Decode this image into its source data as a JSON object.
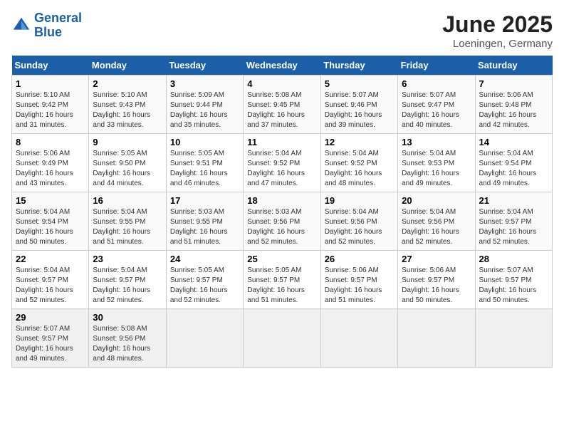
{
  "header": {
    "logo_line1": "General",
    "logo_line2": "Blue",
    "title": "June 2025",
    "subtitle": "Loeningen, Germany"
  },
  "calendar": {
    "days_of_week": [
      "Sunday",
      "Monday",
      "Tuesday",
      "Wednesday",
      "Thursday",
      "Friday",
      "Saturday"
    ],
    "weeks": [
      [
        {
          "day": "",
          "info": ""
        },
        {
          "day": "",
          "info": ""
        },
        {
          "day": "",
          "info": ""
        },
        {
          "day": "",
          "info": ""
        },
        {
          "day": "",
          "info": ""
        },
        {
          "day": "",
          "info": ""
        },
        {
          "day": "7",
          "info": "Sunrise: 5:06 AM\nSunset: 9:48 PM\nDaylight: 16 hours\nand 42 minutes."
        }
      ],
      [
        {
          "day": "1",
          "info": "Sunrise: 5:10 AM\nSunset: 9:42 PM\nDaylight: 16 hours\nand 31 minutes."
        },
        {
          "day": "2",
          "info": "Sunrise: 5:10 AM\nSunset: 9:43 PM\nDaylight: 16 hours\nand 33 minutes."
        },
        {
          "day": "3",
          "info": "Sunrise: 5:09 AM\nSunset: 9:44 PM\nDaylight: 16 hours\nand 35 minutes."
        },
        {
          "day": "4",
          "info": "Sunrise: 5:08 AM\nSunset: 9:45 PM\nDaylight: 16 hours\nand 37 minutes."
        },
        {
          "day": "5",
          "info": "Sunrise: 5:07 AM\nSunset: 9:46 PM\nDaylight: 16 hours\nand 39 minutes."
        },
        {
          "day": "6",
          "info": "Sunrise: 5:07 AM\nSunset: 9:47 PM\nDaylight: 16 hours\nand 40 minutes."
        },
        {
          "day": "7",
          "info": "Sunrise: 5:06 AM\nSunset: 9:48 PM\nDaylight: 16 hours\nand 42 minutes."
        }
      ],
      [
        {
          "day": "8",
          "info": "Sunrise: 5:06 AM\nSunset: 9:49 PM\nDaylight: 16 hours\nand 43 minutes."
        },
        {
          "day": "9",
          "info": "Sunrise: 5:05 AM\nSunset: 9:50 PM\nDaylight: 16 hours\nand 44 minutes."
        },
        {
          "day": "10",
          "info": "Sunrise: 5:05 AM\nSunset: 9:51 PM\nDaylight: 16 hours\nand 46 minutes."
        },
        {
          "day": "11",
          "info": "Sunrise: 5:04 AM\nSunset: 9:52 PM\nDaylight: 16 hours\nand 47 minutes."
        },
        {
          "day": "12",
          "info": "Sunrise: 5:04 AM\nSunset: 9:52 PM\nDaylight: 16 hours\nand 48 minutes."
        },
        {
          "day": "13",
          "info": "Sunrise: 5:04 AM\nSunset: 9:53 PM\nDaylight: 16 hours\nand 49 minutes."
        },
        {
          "day": "14",
          "info": "Sunrise: 5:04 AM\nSunset: 9:54 PM\nDaylight: 16 hours\nand 49 minutes."
        }
      ],
      [
        {
          "day": "15",
          "info": "Sunrise: 5:04 AM\nSunset: 9:54 PM\nDaylight: 16 hours\nand 50 minutes."
        },
        {
          "day": "16",
          "info": "Sunrise: 5:04 AM\nSunset: 9:55 PM\nDaylight: 16 hours\nand 51 minutes."
        },
        {
          "day": "17",
          "info": "Sunrise: 5:03 AM\nSunset: 9:55 PM\nDaylight: 16 hours\nand 51 minutes."
        },
        {
          "day": "18",
          "info": "Sunrise: 5:03 AM\nSunset: 9:56 PM\nDaylight: 16 hours\nand 52 minutes."
        },
        {
          "day": "19",
          "info": "Sunrise: 5:04 AM\nSunset: 9:56 PM\nDaylight: 16 hours\nand 52 minutes."
        },
        {
          "day": "20",
          "info": "Sunrise: 5:04 AM\nSunset: 9:56 PM\nDaylight: 16 hours\nand 52 minutes."
        },
        {
          "day": "21",
          "info": "Sunrise: 5:04 AM\nSunset: 9:57 PM\nDaylight: 16 hours\nand 52 minutes."
        }
      ],
      [
        {
          "day": "22",
          "info": "Sunrise: 5:04 AM\nSunset: 9:57 PM\nDaylight: 16 hours\nand 52 minutes."
        },
        {
          "day": "23",
          "info": "Sunrise: 5:04 AM\nSunset: 9:57 PM\nDaylight: 16 hours\nand 52 minutes."
        },
        {
          "day": "24",
          "info": "Sunrise: 5:05 AM\nSunset: 9:57 PM\nDaylight: 16 hours\nand 52 minutes."
        },
        {
          "day": "25",
          "info": "Sunrise: 5:05 AM\nSunset: 9:57 PM\nDaylight: 16 hours\nand 51 minutes."
        },
        {
          "day": "26",
          "info": "Sunrise: 5:06 AM\nSunset: 9:57 PM\nDaylight: 16 hours\nand 51 minutes."
        },
        {
          "day": "27",
          "info": "Sunrise: 5:06 AM\nSunset: 9:57 PM\nDaylight: 16 hours\nand 50 minutes."
        },
        {
          "day": "28",
          "info": "Sunrise: 5:07 AM\nSunset: 9:57 PM\nDaylight: 16 hours\nand 50 minutes."
        }
      ],
      [
        {
          "day": "29",
          "info": "Sunrise: 5:07 AM\nSunset: 9:57 PM\nDaylight: 16 hours\nand 49 minutes."
        },
        {
          "day": "30",
          "info": "Sunrise: 5:08 AM\nSunset: 9:56 PM\nDaylight: 16 hours\nand 48 minutes."
        },
        {
          "day": "",
          "info": ""
        },
        {
          "day": "",
          "info": ""
        },
        {
          "day": "",
          "info": ""
        },
        {
          "day": "",
          "info": ""
        },
        {
          "day": "",
          "info": ""
        }
      ]
    ]
  }
}
